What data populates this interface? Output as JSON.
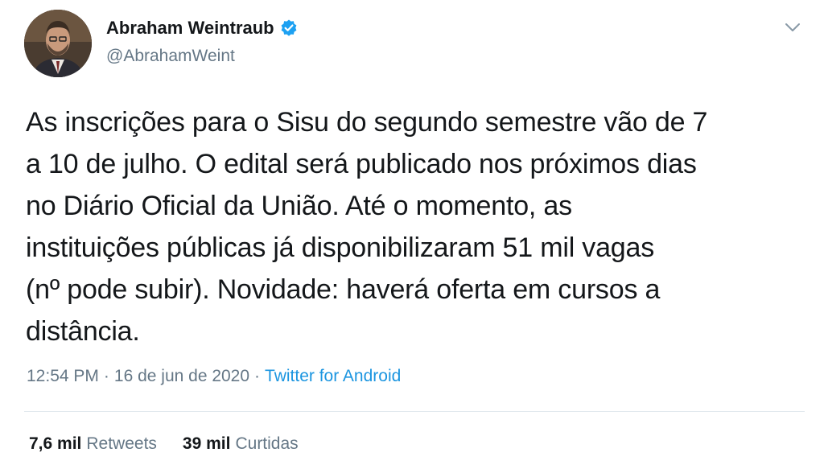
{
  "author": {
    "display_name": "Abraham Weintraub",
    "handle": "@AbrahamWeint",
    "verified_color": "#1da1f2"
  },
  "tweet": {
    "lines": [
      "As inscrições para o Sisu do segundo semestre vão de 7",
      "a 10 de julho. O edital será publicado nos próximos dias",
      "no Diário Oficial da União. Até o momento, as",
      "instituições públicas já disponibilizaram 51 mil vagas",
      "(nº pode subir). Novidade: haverá oferta em cursos a",
      "distância."
    ]
  },
  "meta": {
    "time": "12:54 PM",
    "separator": "·",
    "date": "16 de jun de 2020",
    "source": "Twitter for Android"
  },
  "stats": {
    "retweets_count": "7,6 mil",
    "retweets_label": "Retweets",
    "likes_count": "39 mil",
    "likes_label": "Curtidas"
  },
  "icons": {
    "verified": "verified-badge-icon",
    "caret": "chevron-down-icon"
  },
  "colors": {
    "text": "#14171a",
    "secondary": "#657786",
    "link": "#1b95e0",
    "divider": "#e1e8ed"
  }
}
